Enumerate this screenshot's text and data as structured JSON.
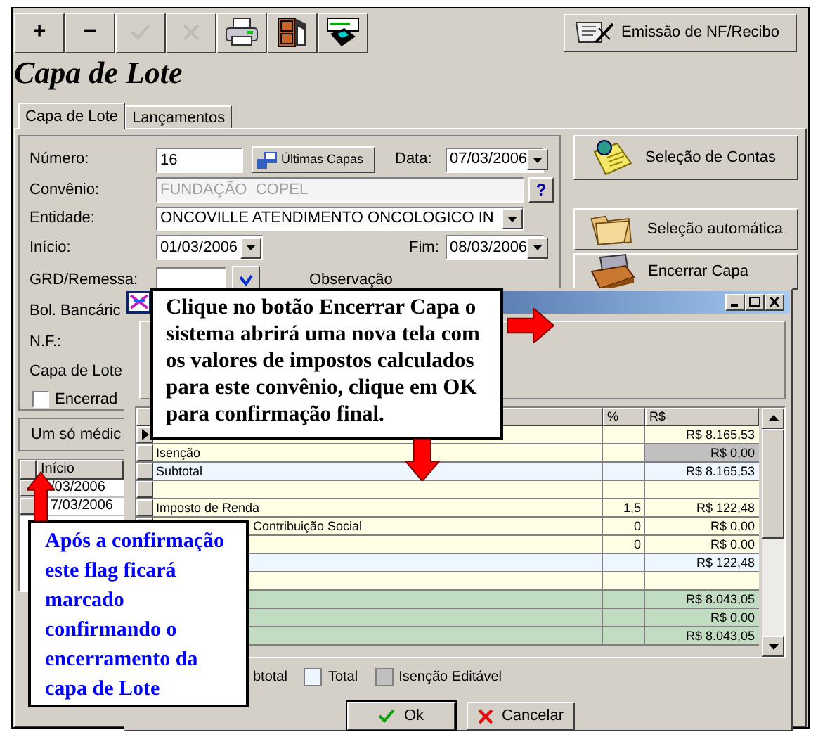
{
  "toolbar": [
    {
      "kind": "text",
      "label": "+",
      "disabled": false
    },
    {
      "kind": "text",
      "label": "−",
      "disabled": false
    },
    {
      "kind": "check",
      "disabled": true
    },
    {
      "kind": "cross",
      "disabled": true
    },
    {
      "kind": "printer",
      "disabled": false
    },
    {
      "kind": "door",
      "disabled": false
    },
    {
      "kind": "disk",
      "disabled": false
    }
  ],
  "emit_button": "Emissão de NF/Recibo",
  "title": "Capa de Lote",
  "tabs": [
    {
      "label": "Capa de Lote",
      "selected": true
    },
    {
      "label": "Lançamentos",
      "selected": false
    }
  ],
  "form": {
    "numero": {
      "label": "Número:",
      "value": "16"
    },
    "ultimas_button": "Últimas Capas",
    "data": {
      "label": "Data:",
      "value": "07/03/2006"
    },
    "convenio": {
      "label": "Convênio:",
      "value": "FUNDAÇÃO  COPEL",
      "disabled": true
    },
    "help_button": "?",
    "entidade": {
      "label": "Entidade:",
      "value": "ONCOVILLE ATENDIMENTO ONCOLOGICO IN"
    },
    "inicio": {
      "label": "Início:",
      "value": "01/03/2006"
    },
    "fim": {
      "label": "Fim:",
      "value": "08/03/2006"
    },
    "grd": {
      "label": "GRD/Remessa:"
    },
    "observacao": "Observação",
    "bol_bancario": "Bol. Bancáric",
    "nf": "N.F.:",
    "capa": "Capa de Lote",
    "encerrada": {
      "label": "Encerrad",
      "checked": false
    }
  },
  "right_buttons": [
    {
      "kind": "notes",
      "label": "Seleção de Contas"
    },
    {
      "kind": "folder",
      "label": "Seleção automática"
    },
    {
      "kind": "cardbox",
      "label": "Encerrar Capa"
    }
  ],
  "um_so_medico": "Um só médic",
  "mini_grid": {
    "column": "Início",
    "rows": [
      "/03/2006",
      "7/03/2006"
    ]
  },
  "dialog": {
    "columns": [
      "%",
      "R$"
    ],
    "rows": [
      {
        "kind": "current",
        "label": "",
        "pct": "",
        "value": "R$ 8.165,53",
        "color": "#ffffe6"
      },
      {
        "kind": "plain",
        "label": "Isenção",
        "pct": "",
        "value": "R$ 0,00",
        "color": "#ffffe6",
        "value_cell": {
          "color": "#c0c0c0"
        }
      },
      {
        "kind": "plain",
        "label": "Subtotal",
        "pct": "",
        "value": "R$ 8.165,53",
        "color": "#eef7ff"
      },
      {
        "kind": "plain",
        "label": "",
        "pct": "",
        "value": "",
        "color": "#ffffe6"
      },
      {
        "kind": "plain",
        "label": "Imposto de Renda",
        "pct": "1,5",
        "value": "R$ 122,48",
        "color": "#ffffe6"
      },
      {
        "kind": "covered",
        "label": "Contribuição Social",
        "pct": "0",
        "value": "R$ 0,00",
        "color": "#ffffe6"
      },
      {
        "kind": "covered",
        "label": "",
        "pct": "0",
        "value": "R$ 0,00",
        "color": "#ffffe6"
      },
      {
        "kind": "covered",
        "label": "",
        "pct": "",
        "value": "R$ 122,48",
        "color": "#eef7ff"
      },
      {
        "kind": "covered",
        "label": "",
        "pct": "",
        "value": "",
        "color": "#ffffe6"
      },
      {
        "kind": "covered",
        "label": "",
        "pct": "",
        "value": "R$ 8.043,05",
        "color": "#c2dcc2"
      },
      {
        "kind": "covered",
        "label": "",
        "pct": "",
        "value": "R$ 0,00",
        "color": "#c2dcc2"
      },
      {
        "kind": "covered",
        "label": "",
        "pct": "",
        "value": "R$ 8.043,05",
        "color": "#c2dcc2"
      }
    ],
    "legend": [
      {
        "label": "btotal"
      },
      {
        "label": "Total",
        "color": "#eef7ff"
      },
      {
        "label": "Isenção Editável",
        "color": "#c0c0c0"
      }
    ],
    "buttons": [
      {
        "kind": "ok",
        "label": "Ok"
      },
      {
        "kind": "cancel",
        "label": "Cancelar"
      }
    ]
  },
  "callouts": [
    {
      "text": "Clique no botão Encerrar Capa o sistema abrirá uma nova tela com os valores de impostos calculados para este convênio, clique em OK para confirmação final."
    },
    {
      "text": "Após a confirmação este flag ficará marcado confirmando o encerramento da capa de Lote"
    }
  ]
}
